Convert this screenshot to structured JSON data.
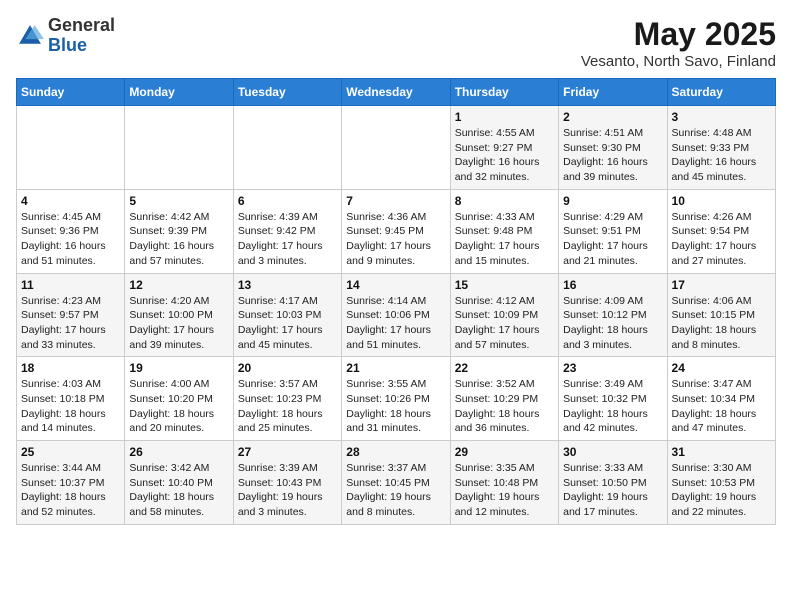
{
  "logo": {
    "general": "General",
    "blue": "Blue"
  },
  "title": "May 2025",
  "subtitle": "Vesanto, North Savo, Finland",
  "days_of_week": [
    "Sunday",
    "Monday",
    "Tuesday",
    "Wednesday",
    "Thursday",
    "Friday",
    "Saturday"
  ],
  "weeks": [
    [
      {
        "day": "",
        "info": ""
      },
      {
        "day": "",
        "info": ""
      },
      {
        "day": "",
        "info": ""
      },
      {
        "day": "",
        "info": ""
      },
      {
        "day": "1",
        "info": "Sunrise: 4:55 AM\nSunset: 9:27 PM\nDaylight: 16 hours\nand 32 minutes."
      },
      {
        "day": "2",
        "info": "Sunrise: 4:51 AM\nSunset: 9:30 PM\nDaylight: 16 hours\nand 39 minutes."
      },
      {
        "day": "3",
        "info": "Sunrise: 4:48 AM\nSunset: 9:33 PM\nDaylight: 16 hours\nand 45 minutes."
      }
    ],
    [
      {
        "day": "4",
        "info": "Sunrise: 4:45 AM\nSunset: 9:36 PM\nDaylight: 16 hours\nand 51 minutes."
      },
      {
        "day": "5",
        "info": "Sunrise: 4:42 AM\nSunset: 9:39 PM\nDaylight: 16 hours\nand 57 minutes."
      },
      {
        "day": "6",
        "info": "Sunrise: 4:39 AM\nSunset: 9:42 PM\nDaylight: 17 hours\nand 3 minutes."
      },
      {
        "day": "7",
        "info": "Sunrise: 4:36 AM\nSunset: 9:45 PM\nDaylight: 17 hours\nand 9 minutes."
      },
      {
        "day": "8",
        "info": "Sunrise: 4:33 AM\nSunset: 9:48 PM\nDaylight: 17 hours\nand 15 minutes."
      },
      {
        "day": "9",
        "info": "Sunrise: 4:29 AM\nSunset: 9:51 PM\nDaylight: 17 hours\nand 21 minutes."
      },
      {
        "day": "10",
        "info": "Sunrise: 4:26 AM\nSunset: 9:54 PM\nDaylight: 17 hours\nand 27 minutes."
      }
    ],
    [
      {
        "day": "11",
        "info": "Sunrise: 4:23 AM\nSunset: 9:57 PM\nDaylight: 17 hours\nand 33 minutes."
      },
      {
        "day": "12",
        "info": "Sunrise: 4:20 AM\nSunset: 10:00 PM\nDaylight: 17 hours\nand 39 minutes."
      },
      {
        "day": "13",
        "info": "Sunrise: 4:17 AM\nSunset: 10:03 PM\nDaylight: 17 hours\nand 45 minutes."
      },
      {
        "day": "14",
        "info": "Sunrise: 4:14 AM\nSunset: 10:06 PM\nDaylight: 17 hours\nand 51 minutes."
      },
      {
        "day": "15",
        "info": "Sunrise: 4:12 AM\nSunset: 10:09 PM\nDaylight: 17 hours\nand 57 minutes."
      },
      {
        "day": "16",
        "info": "Sunrise: 4:09 AM\nSunset: 10:12 PM\nDaylight: 18 hours\nand 3 minutes."
      },
      {
        "day": "17",
        "info": "Sunrise: 4:06 AM\nSunset: 10:15 PM\nDaylight: 18 hours\nand 8 minutes."
      }
    ],
    [
      {
        "day": "18",
        "info": "Sunrise: 4:03 AM\nSunset: 10:18 PM\nDaylight: 18 hours\nand 14 minutes."
      },
      {
        "day": "19",
        "info": "Sunrise: 4:00 AM\nSunset: 10:20 PM\nDaylight: 18 hours\nand 20 minutes."
      },
      {
        "day": "20",
        "info": "Sunrise: 3:57 AM\nSunset: 10:23 PM\nDaylight: 18 hours\nand 25 minutes."
      },
      {
        "day": "21",
        "info": "Sunrise: 3:55 AM\nSunset: 10:26 PM\nDaylight: 18 hours\nand 31 minutes."
      },
      {
        "day": "22",
        "info": "Sunrise: 3:52 AM\nSunset: 10:29 PM\nDaylight: 18 hours\nand 36 minutes."
      },
      {
        "day": "23",
        "info": "Sunrise: 3:49 AM\nSunset: 10:32 PM\nDaylight: 18 hours\nand 42 minutes."
      },
      {
        "day": "24",
        "info": "Sunrise: 3:47 AM\nSunset: 10:34 PM\nDaylight: 18 hours\nand 47 minutes."
      }
    ],
    [
      {
        "day": "25",
        "info": "Sunrise: 3:44 AM\nSunset: 10:37 PM\nDaylight: 18 hours\nand 52 minutes."
      },
      {
        "day": "26",
        "info": "Sunrise: 3:42 AM\nSunset: 10:40 PM\nDaylight: 18 hours\nand 58 minutes."
      },
      {
        "day": "27",
        "info": "Sunrise: 3:39 AM\nSunset: 10:43 PM\nDaylight: 19 hours\nand 3 minutes."
      },
      {
        "day": "28",
        "info": "Sunrise: 3:37 AM\nSunset: 10:45 PM\nDaylight: 19 hours\nand 8 minutes."
      },
      {
        "day": "29",
        "info": "Sunrise: 3:35 AM\nSunset: 10:48 PM\nDaylight: 19 hours\nand 12 minutes."
      },
      {
        "day": "30",
        "info": "Sunrise: 3:33 AM\nSunset: 10:50 PM\nDaylight: 19 hours\nand 17 minutes."
      },
      {
        "day": "31",
        "info": "Sunrise: 3:30 AM\nSunset: 10:53 PM\nDaylight: 19 hours\nand 22 minutes."
      }
    ]
  ]
}
